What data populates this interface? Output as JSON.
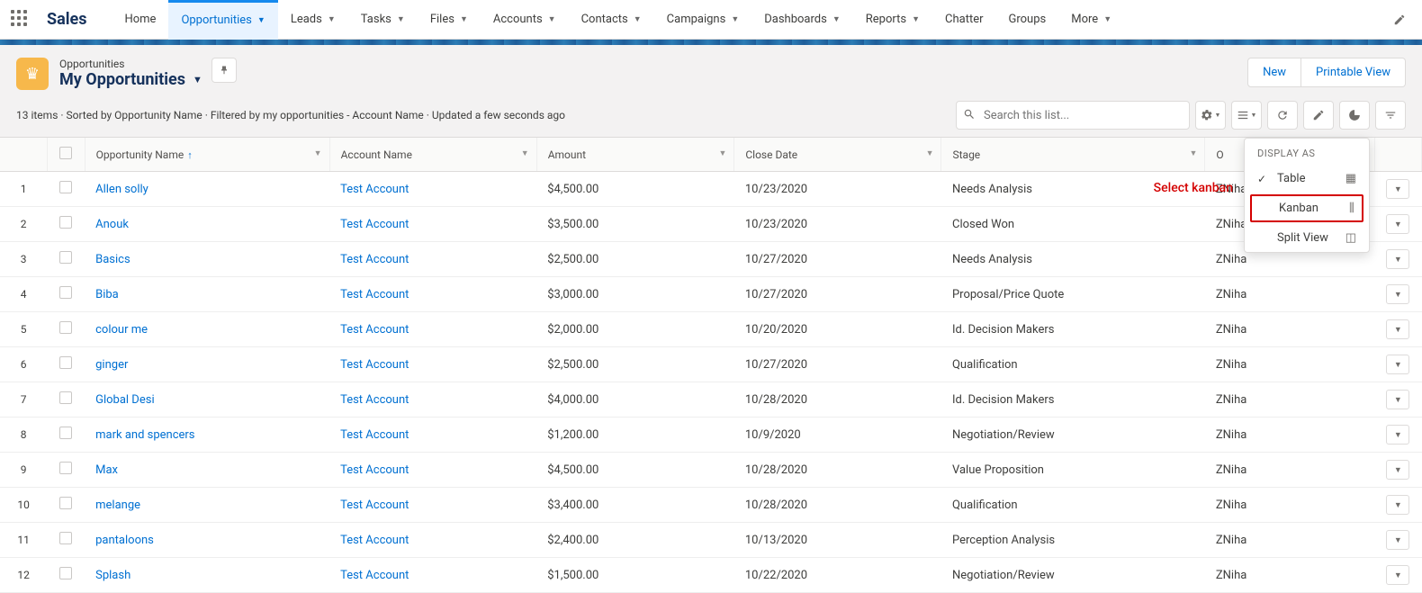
{
  "nav": {
    "app": "Sales",
    "tabs": [
      "Home",
      "Opportunities",
      "Leads",
      "Tasks",
      "Files",
      "Accounts",
      "Contacts",
      "Campaigns",
      "Dashboards",
      "Reports",
      "Chatter",
      "Groups",
      "More"
    ],
    "activeIndex": 1,
    "noChevron": [
      "Home",
      "Chatter",
      "Groups"
    ]
  },
  "header": {
    "object": "Opportunities",
    "listView": "My Opportunities",
    "meta": "13 items · Sorted by Opportunity Name · Filtered by my opportunities - Account Name · Updated a few seconds ago",
    "buttons": {
      "new": "New",
      "print": "Printable View"
    },
    "search_placeholder": "Search this list..."
  },
  "columns": [
    "Opportunity Name",
    "Account Name",
    "Amount",
    "Close Date",
    "Stage",
    "Opportunity Owner Alias"
  ],
  "rows": [
    {
      "n": 1,
      "opp": "Allen solly",
      "acct": "Test Account",
      "amt": "$4,500.00",
      "date": "10/23/2020",
      "stage": "Needs Analysis",
      "alias": "ZNiha"
    },
    {
      "n": 2,
      "opp": "Anouk",
      "acct": "Test Account",
      "amt": "$3,500.00",
      "date": "10/23/2020",
      "stage": "Closed Won",
      "alias": "ZNiha"
    },
    {
      "n": 3,
      "opp": "Basics",
      "acct": "Test Account",
      "amt": "$2,500.00",
      "date": "10/27/2020",
      "stage": "Needs Analysis",
      "alias": "ZNiha"
    },
    {
      "n": 4,
      "opp": "Biba",
      "acct": "Test Account",
      "amt": "$3,000.00",
      "date": "10/27/2020",
      "stage": "Proposal/Price Quote",
      "alias": "ZNiha"
    },
    {
      "n": 5,
      "opp": "colour me",
      "acct": "Test Account",
      "amt": "$2,000.00",
      "date": "10/20/2020",
      "stage": "Id. Decision Makers",
      "alias": "ZNiha"
    },
    {
      "n": 6,
      "opp": "ginger",
      "acct": "Test Account",
      "amt": "$2,500.00",
      "date": "10/27/2020",
      "stage": "Qualification",
      "alias": "ZNiha"
    },
    {
      "n": 7,
      "opp": "Global Desi",
      "acct": "Test Account",
      "amt": "$4,000.00",
      "date": "10/28/2020",
      "stage": "Id. Decision Makers",
      "alias": "ZNiha"
    },
    {
      "n": 8,
      "opp": "mark and spencers",
      "acct": "Test Account",
      "amt": "$1,200.00",
      "date": "10/9/2020",
      "stage": "Negotiation/Review",
      "alias": "ZNiha"
    },
    {
      "n": 9,
      "opp": "Max",
      "acct": "Test Account",
      "amt": "$4,500.00",
      "date": "10/28/2020",
      "stage": "Value Proposition",
      "alias": "ZNiha"
    },
    {
      "n": 10,
      "opp": "melange",
      "acct": "Test Account",
      "amt": "$3,400.00",
      "date": "10/28/2020",
      "stage": "Qualification",
      "alias": "ZNiha"
    },
    {
      "n": 11,
      "opp": "pantaloons",
      "acct": "Test Account",
      "amt": "$2,400.00",
      "date": "10/13/2020",
      "stage": "Perception Analysis",
      "alias": "ZNiha"
    },
    {
      "n": 12,
      "opp": "Splash",
      "acct": "Test Account",
      "amt": "$1,500.00",
      "date": "10/22/2020",
      "stage": "Negotiation/Review",
      "alias": "ZNiha"
    }
  ],
  "popover": {
    "title": "DISPLAY AS",
    "items": [
      "Table",
      "Kanban",
      "Split View"
    ],
    "selected": "Table",
    "highlight": "Kanban"
  },
  "callout": "Select kanban"
}
